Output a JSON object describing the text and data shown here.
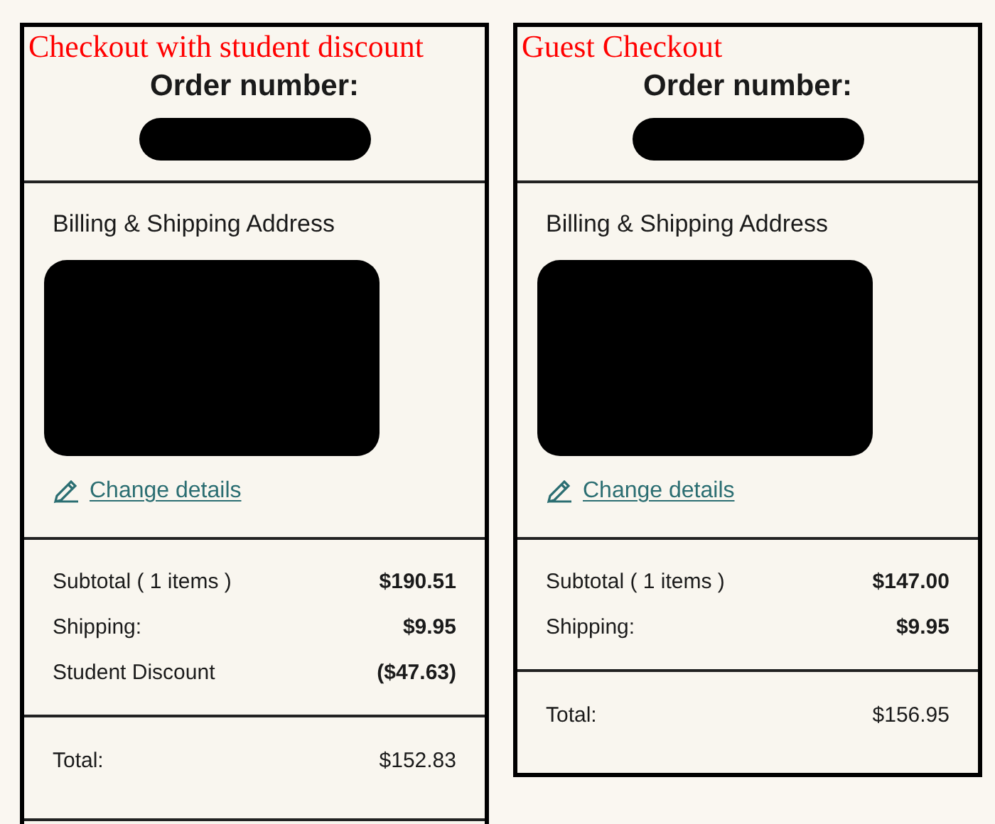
{
  "panels": [
    {
      "annotation": "Checkout with student discount",
      "order_label": "Order number:",
      "address_heading": "Billing & Shipping Address",
      "change_link": "Change details",
      "summary": [
        {
          "label": "Subtotal ( 1 items )",
          "value": "$190.51"
        },
        {
          "label": "Shipping:",
          "value": "$9.95"
        },
        {
          "label": "Student Discount",
          "value": "($47.63)"
        }
      ],
      "total": {
        "label": "Total:",
        "value": "$152.83"
      },
      "more_below": true
    },
    {
      "annotation": "Guest Checkout",
      "order_label": "Order number:",
      "address_heading": "Billing & Shipping Address",
      "change_link": "Change details",
      "summary": [
        {
          "label": "Subtotal ( 1 items )",
          "value": "$147.00"
        },
        {
          "label": "Shipping:",
          "value": "$9.95"
        }
      ],
      "total": {
        "label": "Total:",
        "value": "$156.95"
      },
      "more_below": false
    }
  ]
}
